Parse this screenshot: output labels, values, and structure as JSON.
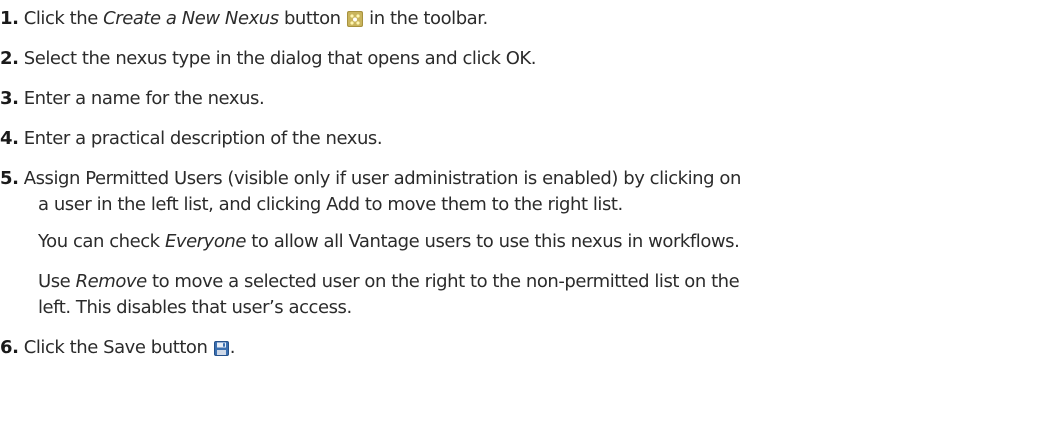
{
  "steps": [
    {
      "number": "1.",
      "text_before": "Click the ",
      "emphasis": "Create a New Nexus",
      "text_after_1": " button ",
      "icon": "new-nexus-icon",
      "text_after_2": " in the toolbar."
    },
    {
      "number": "2.",
      "text": "Select the nexus type in the dialog that opens and click OK."
    },
    {
      "number": "3.",
      "text": "Enter a name for the nexus."
    },
    {
      "number": "4.",
      "text": "Enter a practical description of the nexus."
    },
    {
      "number": "5.",
      "line1": "Assign Permitted Users (visible only if user administration is enabled) by clicking on",
      "line2": "a user in the left list, and clicking Add to move them to the right list.",
      "para1_before": "You can check ",
      "para1_emphasis": "Everyone",
      "para1_after": " to allow all Vantage users to use this nexus in workflows.",
      "para2_before": "Use ",
      "para2_emphasis": "Remove",
      "para2_after": " to move a selected user on the right to the non-permitted list on the",
      "para2_line2": "left. This disables that user’s access."
    },
    {
      "number": "6.",
      "text_before": "Click the Save button ",
      "icon": "save-icon",
      "text_after": "."
    }
  ],
  "colors": {
    "text": "#2b2b2b",
    "nexus_icon_bg": "#b8a24a",
    "save_icon": "#3a6fb0"
  }
}
